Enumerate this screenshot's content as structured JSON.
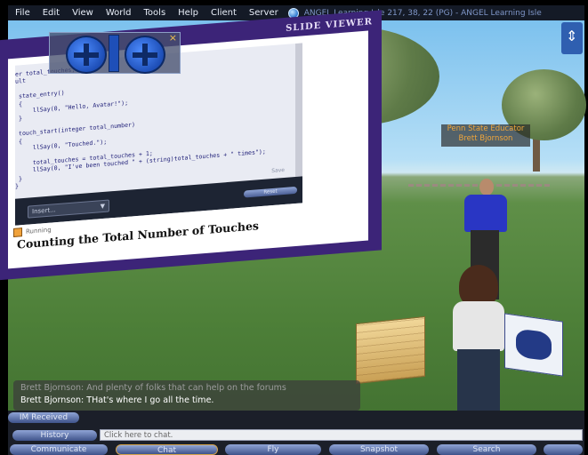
{
  "menubar": {
    "items": [
      "File",
      "Edit",
      "View",
      "World",
      "Tools",
      "Help",
      "Client",
      "Server"
    ],
    "location": "ANGEL Learning Isle 217, 38, 22 (PG) - ANGEL Learning Isle"
  },
  "slide_viewer": {
    "title": "SLIDE VIEWER",
    "code_lines": [
      "er total_touches;",
      "ult",
      "",
      " state_entry()",
      " {",
      "     llSay(0, \"Hello, Avatar!\");",
      " }",
      "",
      " touch_start(integer total_number)",
      " {",
      "     llSay(0, \"Touched.\");",
      "",
      "     total_touches = total_touches + 1;",
      "     llSay(0, \"I've been touched \" + (string)total_touches + \" times\");",
      " }",
      "}"
    ],
    "insert_label": "Insert...",
    "save_label": "Save",
    "reset_label": "Reset",
    "running_label": "Running",
    "caption": "Counting the Total Number of Touches"
  },
  "avatar_name_tag": {
    "line1": "Penn State Educator",
    "line2": "Brett Bjornson"
  },
  "chat_history": {
    "line1": "Brett Bjornson: And plenty of folks that can help on the forums",
    "line2": "Brett Bjornson: THat's where I go all the time."
  },
  "bottom_bar": {
    "im_received": "IM Received",
    "history": "History",
    "chat_placeholder": "Click here to chat.",
    "buttons": [
      "Communicate",
      "Chat",
      "Fly",
      "Snapshot",
      "Search",
      ""
    ]
  },
  "colors": {
    "menubar_bg": "#141a26",
    "board_frame": "#3c2478",
    "name_tag_text": "#f0a63b",
    "button_gradient_top": "#8fa4d6"
  }
}
